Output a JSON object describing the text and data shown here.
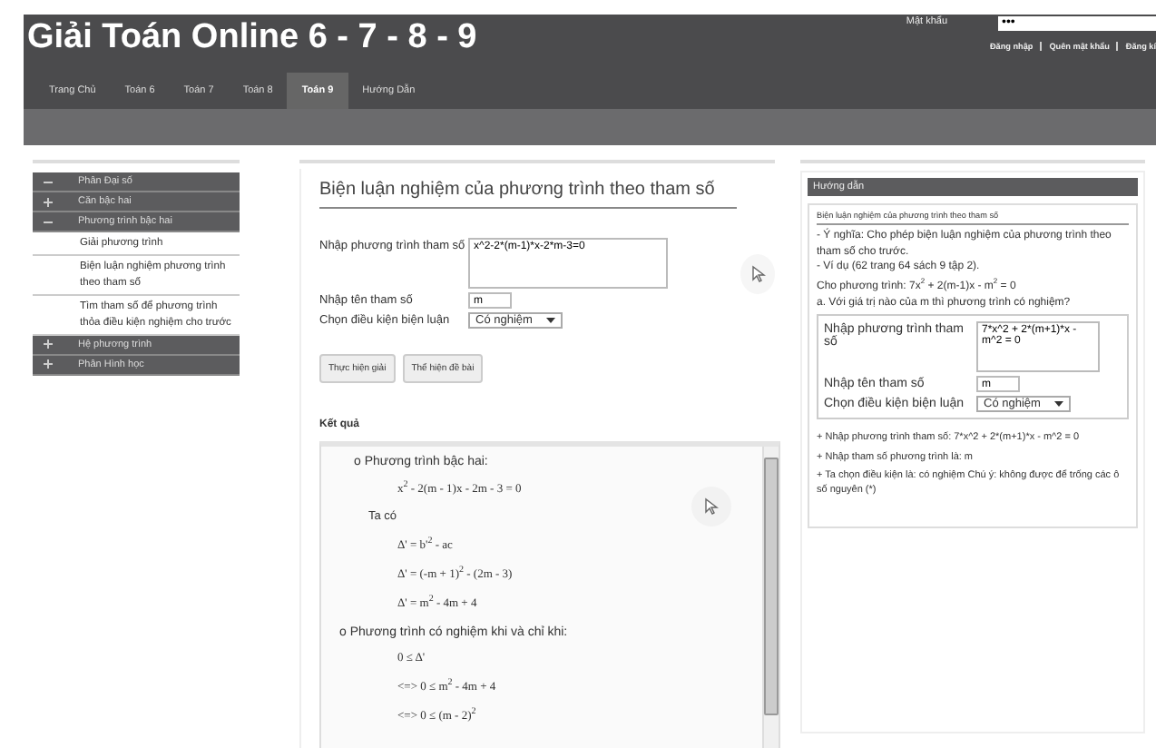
{
  "header": {
    "title": "Giải Toán Online 6 - 7 - 8 - 9",
    "password_label": "Mật khẩu",
    "password_value": "•••",
    "links": [
      "Đăng nhập",
      "Quên mật khẩu",
      "Đăng kí"
    ]
  },
  "nav": [
    {
      "label": "Trang Chủ",
      "selected": false
    },
    {
      "label": "Toán 6",
      "selected": false
    },
    {
      "label": "Toán 7",
      "selected": false
    },
    {
      "label": "Toán 8",
      "selected": false
    },
    {
      "label": "Toán 9",
      "selected": true
    },
    {
      "label": "Hướng Dẫn",
      "selected": false
    }
  ],
  "sidebar": {
    "items": [
      {
        "label": "Phân Đại số",
        "expanded": true,
        "children": [
          {
            "label": "Căn bậc hai",
            "expanded": false
          },
          {
            "label": "Phương trình bậc hai",
            "expanded": true,
            "children": [
              {
                "label": "Giải phương trình"
              },
              {
                "label": "Biện luận nghiệm phương trình theo tham số"
              },
              {
                "label": "Tìm tham số để phương trình thỏa điều kiện nghiệm cho trước"
              }
            ]
          },
          {
            "label": "Hệ phương trình",
            "expanded": false
          }
        ]
      },
      {
        "label": "Phân Hình học",
        "expanded": false
      }
    ]
  },
  "main": {
    "title": "Biện luận nghiệm của phương trình theo tham số",
    "form": [
      {
        "kind": "textarea",
        "label": "Nhập phương trình tham số",
        "value": "x^2-2*(m-1)*x-2*m-3=0"
      },
      {
        "kind": "text",
        "label": "Nhập tên tham số",
        "value": "m"
      },
      {
        "kind": "select",
        "label": "Chọn điều kiện biện luận",
        "value": "Có nghiệm"
      }
    ],
    "buttons": [
      "Thực hiện giải",
      "Thể hiện đề bài"
    ],
    "result_heading": "Kết quả",
    "result": [
      {
        "kind": "heading",
        "text": "o Phương trình bậc hai:"
      },
      {
        "kind": "math",
        "text": "x$^{2}$ - 2(m - 1)x - 2m - 3 = 0"
      },
      {
        "kind": "text",
        "text": "Ta có"
      },
      {
        "kind": "math",
        "text": "Δ' = b'$^{2}$ - ac"
      },
      {
        "kind": "math",
        "text": "Δ' = (-m + 1)$^{2}$ - (2m - 3)"
      },
      {
        "kind": "math",
        "text": "Δ' = m$^{2}$ - 4m + 4"
      },
      {
        "kind": "heading",
        "text": "o Phương trình có nghiệm khi và chỉ khi:"
      },
      {
        "kind": "math",
        "text": "0 ≤ Δ'"
      },
      {
        "kind": "math",
        "text": "<=> 0 ≤ m$^{2}$ - 4m + 4"
      },
      {
        "kind": "math",
        "text": "<=> 0 ≤ (m - 2)$^{2}$"
      }
    ]
  },
  "guide": {
    "title": "Hướng dẫn",
    "subtitle": "Biện luận nghiệm của phương trình theo tham số",
    "paragraphs": [
      "- Ý nghĩa: Cho phép biện luận nghiệm của phương trình theo tham số cho trước.",
      "- Ví dụ (62 trang 64 sách 9 tập 2).",
      "Cho phương trình: 7x$^{2}$ + 2(m-1)x - m$^{2}$ = 0",
      "a. Với giá trị nào của m thì phương trình có nghiệm?"
    ],
    "form": [
      {
        "kind": "textarea",
        "label": "Nhập phương trình tham số",
        "value": "7*x^2 + 2*(m+1)*x - m^2 = 0"
      },
      {
        "kind": "text",
        "label": "Nhập tên tham số",
        "value": "m"
      },
      {
        "kind": "select",
        "label": "Chọn điều kiện biện luận",
        "value": "Có nghiệm"
      }
    ],
    "notes": [
      "+ Nhập phương trình tham số: 7*x^2 + 2*(m+1)*x - m^2 = 0",
      "+ Nhập tham số phương trình là: m",
      "+ Ta chọn điều kiện là: có nghiệm Chú ý: không được để trống các ô số nguyên (*)"
    ]
  }
}
